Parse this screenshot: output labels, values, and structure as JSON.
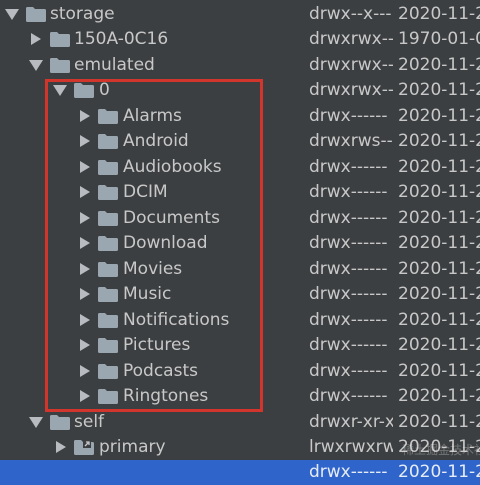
{
  "tree": {
    "rows": [
      {
        "name": "storage",
        "perm": "drwx--x---",
        "date": "2020-11-2",
        "expanded": true,
        "icon": "folder-icon"
      },
      {
        "name": "150A-0C16",
        "perm": "drwxrwx---",
        "date": "1970-01-0",
        "expanded": false,
        "icon": "folder-icon"
      },
      {
        "name": "emulated",
        "perm": "drwxrwx---",
        "date": "2020-11-2",
        "expanded": true,
        "icon": "folder-icon"
      },
      {
        "name": "0",
        "perm": "drwxrwx---",
        "date": "2020-11-2",
        "expanded": true,
        "icon": "folder-icon"
      },
      {
        "name": "Alarms",
        "perm": "drwx------",
        "date": "2020-11-2",
        "expanded": false,
        "icon": "folder-icon"
      },
      {
        "name": "Android",
        "perm": "drwxrws---",
        "date": "2020-11-2",
        "expanded": false,
        "icon": "folder-icon"
      },
      {
        "name": "Audiobooks",
        "perm": "drwx------",
        "date": "2020-11-2",
        "expanded": false,
        "icon": "folder-icon"
      },
      {
        "name": "DCIM",
        "perm": "drwx------",
        "date": "2020-11-2",
        "expanded": false,
        "icon": "folder-icon"
      },
      {
        "name": "Documents",
        "perm": "drwx------",
        "date": "2020-11-2",
        "expanded": false,
        "icon": "folder-icon"
      },
      {
        "name": "Download",
        "perm": "drwx------",
        "date": "2020-11-2",
        "expanded": false,
        "icon": "folder-icon"
      },
      {
        "name": "Movies",
        "perm": "drwx------",
        "date": "2020-11-2",
        "expanded": false,
        "icon": "folder-icon"
      },
      {
        "name": "Music",
        "perm": "drwx------",
        "date": "2020-11-2",
        "expanded": false,
        "icon": "folder-icon"
      },
      {
        "name": "Notifications",
        "perm": "drwx------",
        "date": "2020-11-2",
        "expanded": false,
        "icon": "folder-icon"
      },
      {
        "name": "Pictures",
        "perm": "drwx------",
        "date": "2020-11-2",
        "expanded": false,
        "icon": "folder-icon"
      },
      {
        "name": "Podcasts",
        "perm": "drwx------",
        "date": "2020-11-2",
        "expanded": false,
        "icon": "folder-icon"
      },
      {
        "name": "Ringtones",
        "perm": "drwx------",
        "date": "2020-11-2",
        "expanded": false,
        "icon": "folder-icon"
      },
      {
        "name": "self",
        "perm": "drwxr-xr-x",
        "date": "2020-11-2",
        "expanded": true,
        "icon": "folder-icon"
      },
      {
        "name": "primary",
        "perm": "lrwxrwxrwx",
        "date": "2020-11-2",
        "expanded": false,
        "icon": "folder-link-icon"
      }
    ],
    "selected_row": {
      "perm": "drwx------",
      "date": "2020-11-2"
    }
  },
  "colors": {
    "background": "#3c3f41",
    "text": "#c8c8c8",
    "arrow": "#b8bcc0",
    "folder": "#9aa7b0",
    "selection": "#2f65ca",
    "highlight_box": "#d1352b"
  },
  "watermark": "稀土掘金技术社区"
}
